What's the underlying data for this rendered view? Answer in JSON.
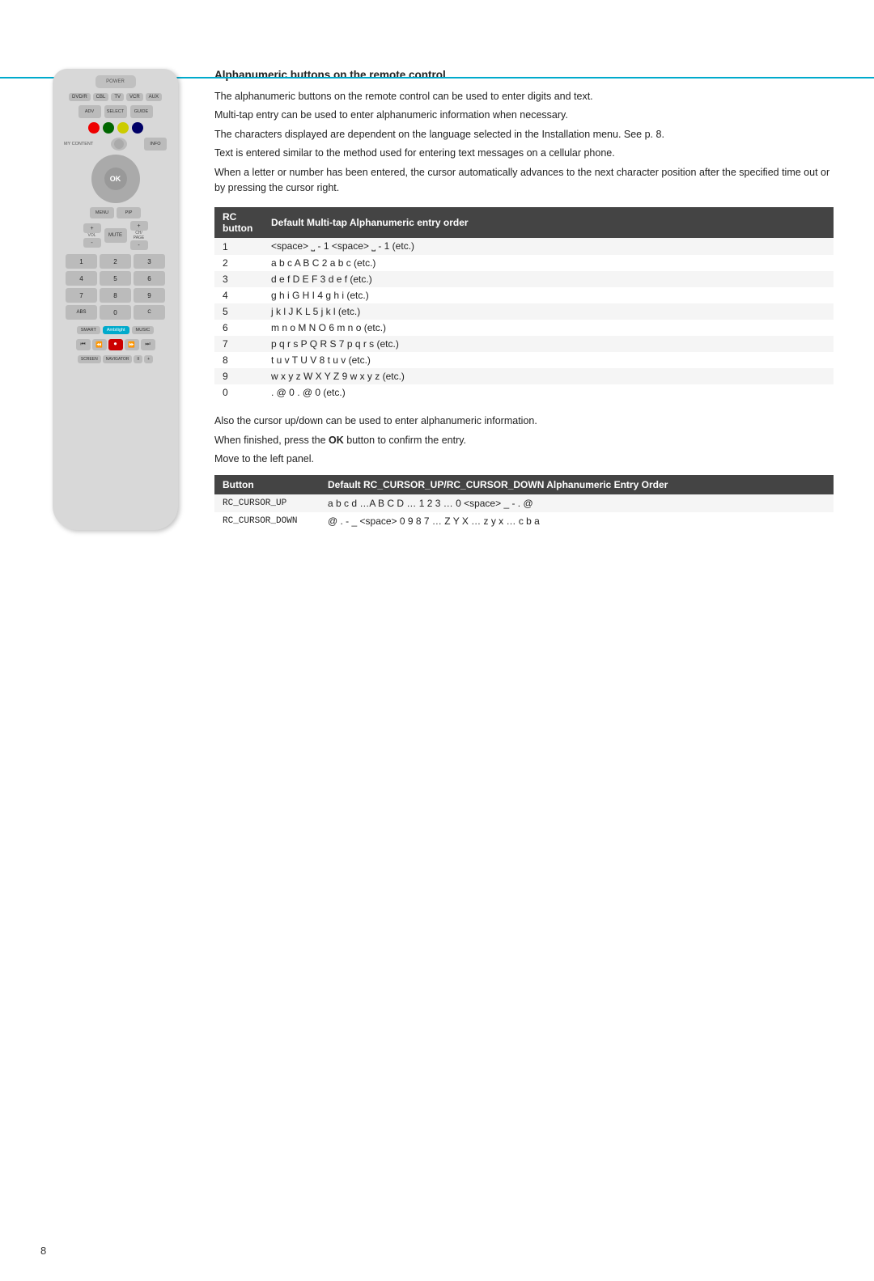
{
  "page": {
    "number": "8",
    "top_border_color": "#00aacc"
  },
  "section": {
    "title": "Alphanumeric buttons on the remote control",
    "paragraphs": [
      "The alphanumeric buttons on the remote control can be used to enter digits and text.",
      "Multi-tap entry can be used to enter alphanumeric information when necessary.",
      "The characters displayed are dependent on the language selected in the Installation menu. See p. 8.",
      "Text is entered similar to the method used for entering text messages on a cellular phone.",
      "When a letter or number has been entered, the cursor automatically advances to the next character position after the specified time out or by pressing the cursor right."
    ]
  },
  "rc_table": {
    "header": [
      "RC button",
      "Default Multi-tap Alphanumeric entry order"
    ],
    "rows": [
      [
        "1",
        "<space> ⎵  - 1 <space> ⎵  - 1 (etc.)"
      ],
      [
        "2",
        "a  b  c  A  B  C  2  a  b  c   (etc.)"
      ],
      [
        "3",
        "d  e  f  D  E  F  3  d  e  f   (etc.)"
      ],
      [
        "4",
        "g  h  i  G  H  I  4  g  h  i   (etc.)"
      ],
      [
        "5",
        "j  k  l  J  K  L  5  j  k  l   (etc.)"
      ],
      [
        "6",
        "m  n  o  M  N  O  6  m  n  o  (etc.)"
      ],
      [
        "7",
        "p  q  r  s  P  Q  R  S  7  p  q  r  s  (etc.)"
      ],
      [
        "8",
        "t  u  v  T  U  V  8  t  u  v  (etc.)"
      ],
      [
        "9",
        "w  x  y  z  W  X  Y  Z  9  w  x  y  z  (etc.)"
      ],
      [
        "0",
        ".  @  0  .  @  0  (etc.)"
      ]
    ]
  },
  "paragraph_after_table": [
    "Also the cursor up/down can be used to enter alphanumeric information.",
    "When finished, press the OK button to confirm the entry.",
    "Move to the left panel."
  ],
  "cursor_table": {
    "header": [
      "Button",
      "Default RC_CURSOR_UP/RC_CURSOR_DOWN Alphanumeric Entry Order"
    ],
    "rows": [
      [
        "RC_CURSOR_UP",
        "a b c d …A B C D … 1 2 3 … 0 <space> _ - . @"
      ],
      [
        "RC_CURSOR_DOWN",
        "@ . - _ <space> 0 9 8 7 … Z Y X … z y x … c b a"
      ]
    ]
  },
  "remote": {
    "top_button": "POWER",
    "mode_buttons": [
      "DVD/R",
      "CBL",
      "TV",
      "VCR",
      "AUX"
    ],
    "row2": [
      "ADV",
      "SELECT",
      "GUIDE"
    ],
    "color_dots": [
      "red",
      "green",
      "yellow",
      "blue"
    ],
    "myfav_label": "MY CONTENT",
    "info_btn": "INFO",
    "ok_label": "OK",
    "menu_btn": "MENU",
    "pip_btn": "PIP",
    "vol_label": "VOL",
    "mute_label": "MUTE",
    "ch_label": "CH/ PAGE",
    "num_buttons": [
      "1",
      "2",
      "3",
      "4",
      "5",
      "6",
      "7",
      "8",
      "9",
      "ABS",
      "0",
      "C"
    ],
    "text_buttons": [
      "SMART",
      "Ambilight",
      "MUSIC"
    ],
    "transport": [
      "⏮",
      "⏪",
      "⏺",
      "⏩",
      "⏭"
    ],
    "extra_row": [
      "SCREEN",
      "NAVIGATOR",
      "II",
      "+"
    ]
  }
}
